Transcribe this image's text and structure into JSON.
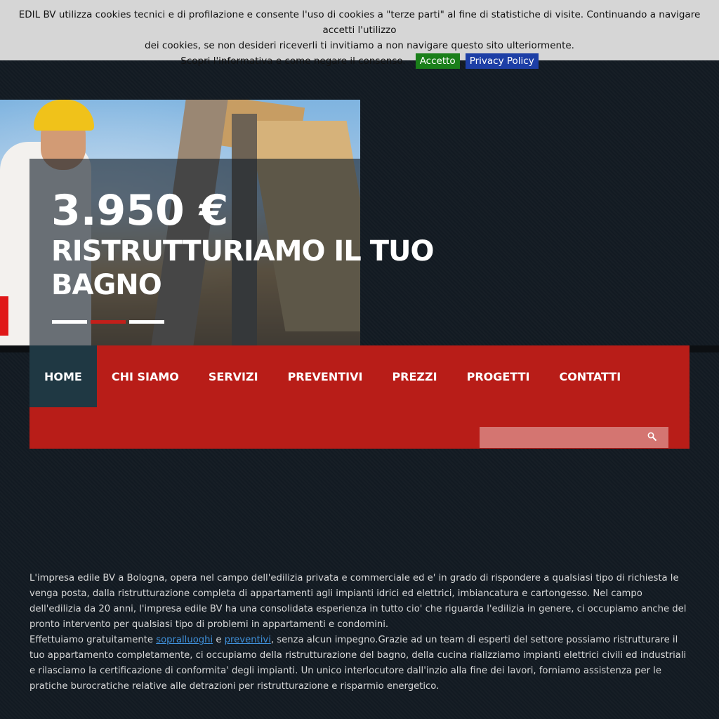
{
  "cookie": {
    "line1": "EDIL BV utilizza cookies tecnici e di profilazione e consente l'uso di cookies a \"terze parti\" al fine di statistiche di visite. Continuando a navigare accetti l'utilizzo",
    "line2": "dei cookies, se non desideri riceverli ti invitiamo a non navigare questo sito ulteriormente.",
    "line3": "Scopri l'informativa e come negare il consenso.",
    "accept_label": "Accetto",
    "privacy_label": "Privacy Policy",
    "accept_color": "#1a7f1a",
    "privacy_color": "#1d3fa6"
  },
  "hero": {
    "price": "3.950 €",
    "title_line1": "RISTRUTTURIAMO IL TUO",
    "title_line2": "BAGNO",
    "active_slide": 2,
    "slide_count": 3
  },
  "nav": {
    "items": [
      {
        "label": "HOME",
        "active": true
      },
      {
        "label": "CHI SIAMO"
      },
      {
        "label": "SERVIZI"
      },
      {
        "label": "PREVENTIVI"
      },
      {
        "label": "PREZZI"
      },
      {
        "label": "PROGETTI"
      },
      {
        "label": "CONTATTI"
      }
    ],
    "bg_color": "#b81d18",
    "active_color": "#1f3843"
  },
  "search": {
    "placeholder": "",
    "icon": "search-icon"
  },
  "content": {
    "p1": "L'impresa edile BV a Bologna, opera nel campo dell'edilizia privata e commerciale ed e' in grado di rispondere a qualsiasi tipo di richiesta le venga posta, dalla ristrutturazione completa di appartamenti agli impianti idrici ed elettrici, imbiancatura e cartongesso. Nel campo dell'edilizia da 20 anni, l'impresa edile BV ha una consolidata esperienza in tutto cio' che riguarda l'edilizia in genere, ci occupiamo anche del pronto intervento per qualsiasi tipo di problemi in appartamenti e condomini.",
    "p2_pre": "Effettuiamo gratuitamente ",
    "link_sopralluoghi": "sopralluoghi",
    "p2_and": " e ",
    "link_preventivi": "preventivi",
    "p2_post": ", senza alcun impegno.Grazie ad un team di esperti del settore possiamo ristrutturare il tuo appartamento completamente, ci occupiamo della ristrutturazione del bagno, della cucina rializziamo impianti elettrici civili ed industriali e rilasciamo la certificazione di conformita' degli impianti. Un unico interlocutore dall'inzio alla fine dei lavori, forniamo assistenza per le pratiche burocratiche relative alle detrazioni per ristrutturazione e risparmio energetico."
  }
}
